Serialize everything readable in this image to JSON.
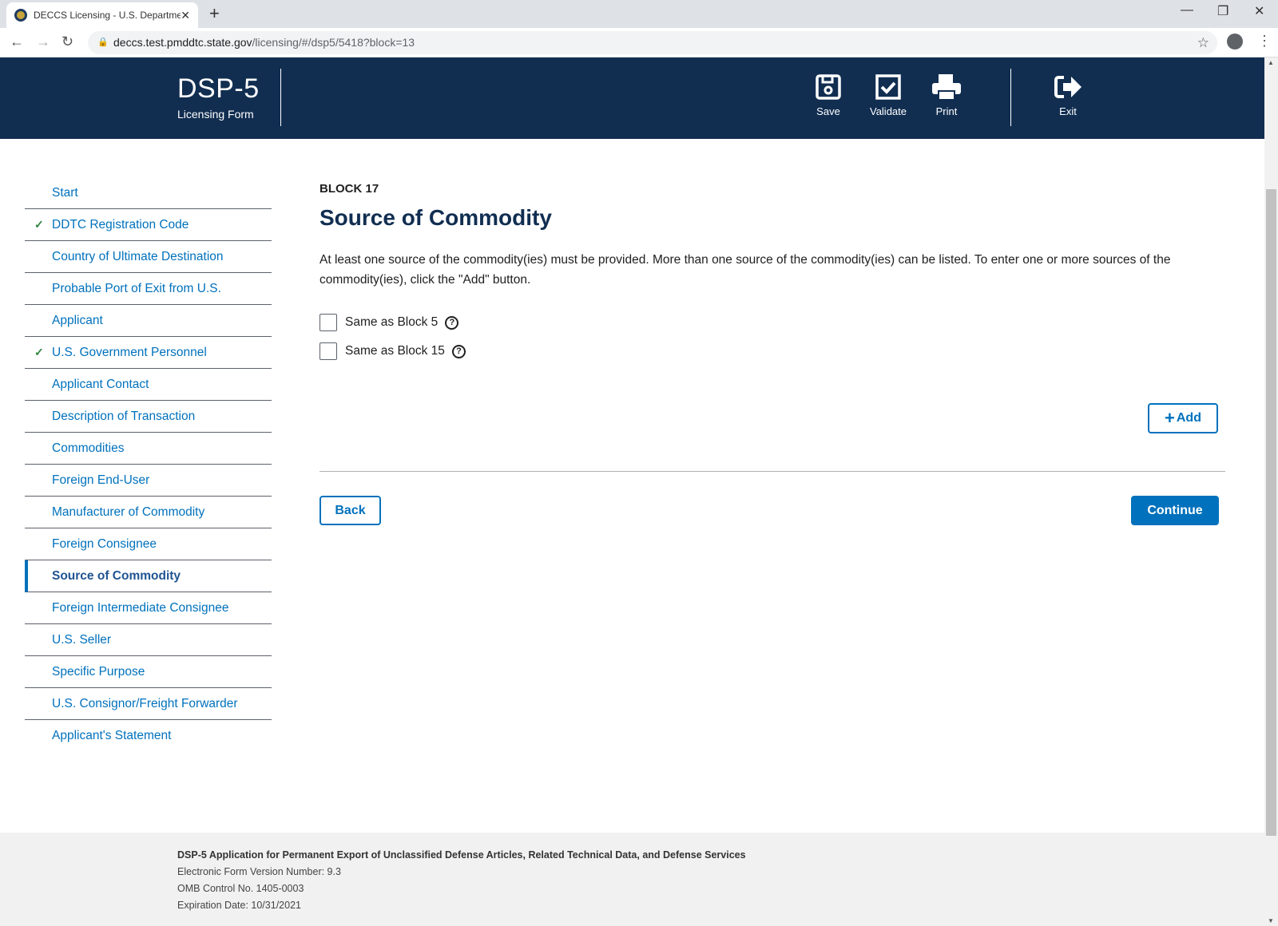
{
  "browser": {
    "tab_title": "DECCS Licensing - U.S. Departme",
    "url_host": "deccs.test.pmddtc.state.gov",
    "url_path": "/licensing/#/dsp5/5418?block=13"
  },
  "header": {
    "title": "DSP-5",
    "subtitle": "Licensing Form",
    "buttons": [
      {
        "label": "Save",
        "icon": "save-icon"
      },
      {
        "label": "Validate",
        "icon": "check-square-icon"
      },
      {
        "label": "Print",
        "icon": "printer-icon"
      },
      {
        "label": "Exit",
        "icon": "sign-out-icon"
      }
    ]
  },
  "sidebar": {
    "items": [
      {
        "label": "Start",
        "done": false
      },
      {
        "label": "DDTC Registration Code",
        "done": true
      },
      {
        "label": "Country of Ultimate Destination",
        "done": false
      },
      {
        "label": "Probable Port of Exit from U.S.",
        "done": false
      },
      {
        "label": "Applicant",
        "done": false
      },
      {
        "label": "U.S. Government Personnel",
        "done": true
      },
      {
        "label": "Applicant Contact",
        "done": false
      },
      {
        "label": "Description of Transaction",
        "done": false
      },
      {
        "label": "Commodities",
        "done": false
      },
      {
        "label": "Foreign End-User",
        "done": false
      },
      {
        "label": "Manufacturer of Commodity",
        "done": false
      },
      {
        "label": "Foreign Consignee",
        "done": false
      },
      {
        "label": "Source of Commodity",
        "done": false,
        "active": true
      },
      {
        "label": "Foreign Intermediate Consignee",
        "done": false
      },
      {
        "label": "U.S. Seller",
        "done": false
      },
      {
        "label": "Specific Purpose",
        "done": false
      },
      {
        "label": "U.S. Consignor/Freight Forwarder",
        "done": false
      },
      {
        "label": "Applicant's Statement",
        "done": false
      }
    ]
  },
  "main": {
    "block": "BLOCK 17",
    "title": "Source of Commodity",
    "description": "At least one source of the commodity(ies) must be provided. More than one source of the commodity(ies) can be listed. To enter one or more sources of the commodity(ies), click the \"Add\" button.",
    "checkboxes": [
      {
        "label": "Same as Block 5",
        "checked": false
      },
      {
        "label": "Same as Block 15",
        "checked": false
      }
    ],
    "add_label": "Add",
    "back_label": "Back",
    "continue_label": "Continue"
  },
  "footer": {
    "title": "DSP-5 Application for Permanent Export of Unclassified Defense Articles, Related Technical Data, and Defense Services",
    "version": "Electronic Form Version Number: 9.3",
    "omb": "OMB Control No. 1405-0003",
    "expiration": "Expiration Date: 10/31/2021"
  },
  "colors": {
    "header_bg": "#112e51",
    "link": "#0071bc",
    "check": "#2e8540"
  }
}
